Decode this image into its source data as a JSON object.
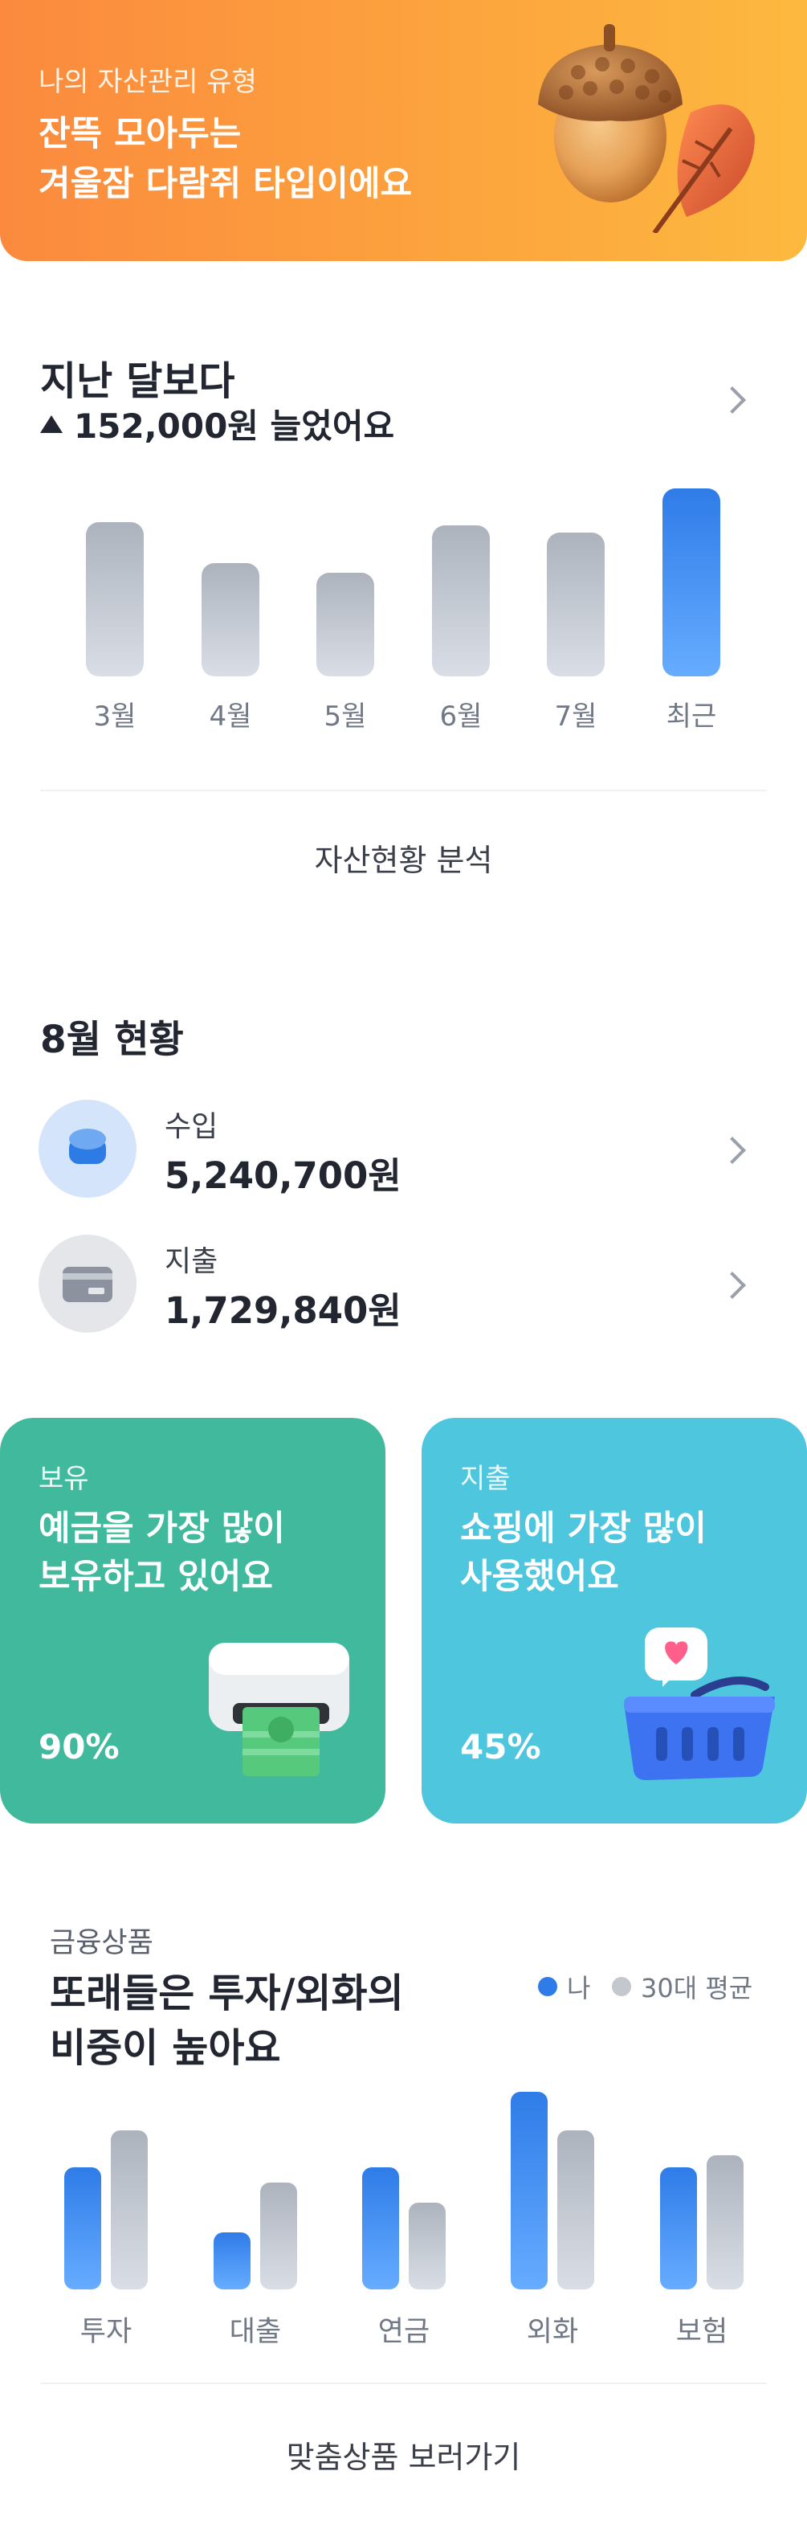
{
  "banner": {
    "subtitle": "나의 자산관리 유형",
    "title_line1": "잔뜩 모아두는",
    "title_line2": "겨울잠 다람쥐 타입이에요",
    "illustration": "acorn-and-leaf"
  },
  "summary": {
    "title": "지난 달보다",
    "change_text": "152,000원 늘었어요",
    "trend_icon": "triangle-up",
    "chevron_icon": "chevron-right"
  },
  "chart_data": {
    "type": "bar",
    "categories": [
      "3월",
      "4월",
      "5월",
      "6월",
      "7월",
      "최근"
    ],
    "values": [
      95,
      70,
      64,
      93,
      89,
      116
    ],
    "highlight": "최근",
    "colors": {
      "default": "#adb3bd",
      "highlight": "#2f7ce8"
    },
    "ylim": [
      0,
      120
    ],
    "grid": false
  },
  "analysis_link": "자산현황 분석",
  "status": {
    "title": "8월 현황",
    "income": {
      "label": "수입",
      "value": "5,240,700원",
      "icon": "coin-stack-icon",
      "color": "#2d7ce6"
    },
    "expense": {
      "label": "지출",
      "value": "1,729,840원",
      "icon": "card-icon",
      "color": "#9aa0ab"
    }
  },
  "cards": {
    "holding": {
      "subtitle": "보유",
      "line1": "예금을 가장 많이",
      "line2": "보유하고 있어요",
      "percent": "90%",
      "color": "#41b99d",
      "icon": "atm-cash-icon"
    },
    "spending": {
      "subtitle": "지출",
      "line1": "쇼핑에 가장 많이",
      "line2": "사용했어요",
      "percent": "45%",
      "color": "#4ec6de",
      "icon": "shopping-basket-icon"
    }
  },
  "products": {
    "subtitle": "금융상품",
    "line1": "또래들은 투자/외화의",
    "line2": "비중이 높아요",
    "legend_me": "나",
    "legend_avg": "30대 평균",
    "chart_data": {
      "type": "bar",
      "categories": [
        "투자",
        "대출",
        "연금",
        "외화",
        "보험"
      ],
      "series": [
        {
          "name": "나",
          "values": [
            73,
            34,
            73,
            118,
            73
          ]
        },
        {
          "name": "30대 평균",
          "values": [
            95,
            64,
            52,
            95,
            80
          ]
        }
      ],
      "colors": [
        "#2f7ce8",
        "#adb3bd"
      ],
      "ylim": [
        0,
        120
      ],
      "legend": "top-right"
    },
    "link": "맞춤상품 보러가기"
  }
}
